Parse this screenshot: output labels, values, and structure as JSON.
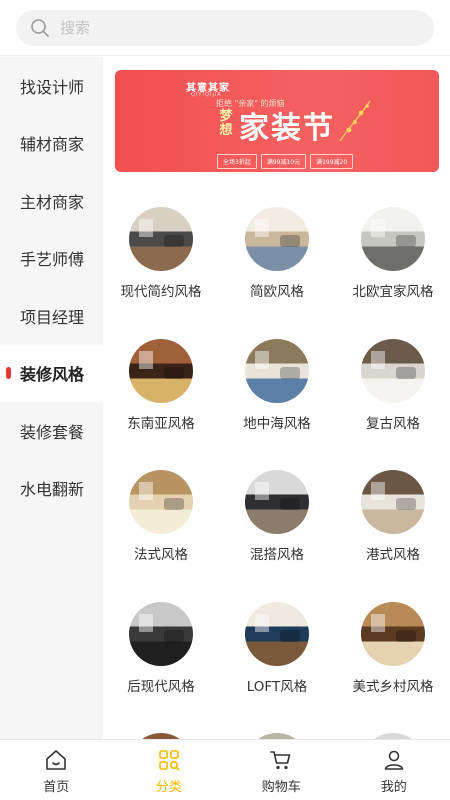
{
  "search": {
    "placeholder": "搜索",
    "icon": "search-icon"
  },
  "sidebar": {
    "items": [
      {
        "label": "找设计师"
      },
      {
        "label": "辅材商家"
      },
      {
        "label": "主材商家"
      },
      {
        "label": "手艺师傅"
      },
      {
        "label": "项目经理"
      },
      {
        "label": "装修风格",
        "active": true
      },
      {
        "label": "装修套餐"
      },
      {
        "label": "水电翻新"
      }
    ]
  },
  "banner": {
    "logo": "其意其家",
    "logo_sub": "QIYIQIJIA",
    "tagline": "拒绝 \"亲家\" 的烦恼",
    "dream": "梦想",
    "title": "家装节",
    "promos": [
      "全场3折起",
      "满99减10元",
      "满199减20"
    ],
    "colors": {
      "background": "#f34f4f",
      "accent": "#fff3a6"
    }
  },
  "styles": [
    {
      "label": "现代简约风格",
      "palette": [
        "#4a4a4a",
        "#d8d0c2",
        "#8b6a4f"
      ]
    },
    {
      "label": "简欧风格",
      "palette": [
        "#c9b79c",
        "#f2ece2",
        "#7b8fa6"
      ]
    },
    {
      "label": "北欧宜家风格",
      "palette": [
        "#c7c7c2",
        "#f1f1ee",
        "#6e6e6a"
      ]
    },
    {
      "label": "东南亚风格",
      "palette": [
        "#3a2418",
        "#a0603a",
        "#d9b26a"
      ]
    },
    {
      "label": "地中海风格",
      "palette": [
        "#e9e4d8",
        "#8c7a5c",
        "#5b7fa6"
      ]
    },
    {
      "label": "复古风格",
      "palette": [
        "#d9d6d0",
        "#6b5b4b",
        "#f5f3ef"
      ]
    },
    {
      "label": "法式风格",
      "palette": [
        "#e5d2b0",
        "#b89463",
        "#f5ecd8"
      ]
    },
    {
      "label": "混搭风格",
      "palette": [
        "#2f2f33",
        "#d9d9d9",
        "#8a7d6b"
      ]
    },
    {
      "label": "港式风格",
      "palette": [
        "#e8e4dc",
        "#6b5844",
        "#c9b89f"
      ]
    },
    {
      "label": "后现代风格",
      "palette": [
        "#3a3a3a",
        "#c8c8c8",
        "#1f1f1f"
      ]
    },
    {
      "label": "LOFT风格",
      "palette": [
        "#1f3d5a",
        "#efe9df",
        "#7a5a3a"
      ]
    },
    {
      "label": "美式乡村风格",
      "palette": [
        "#5c3a22",
        "#b88a56",
        "#e6d2b0"
      ]
    }
  ],
  "tabbar": {
    "items": [
      {
        "label": "首页",
        "icon": "home-icon"
      },
      {
        "label": "分类",
        "icon": "category-icon",
        "active": true
      },
      {
        "label": "购物车",
        "icon": "cart-icon"
      },
      {
        "label": "我的",
        "icon": "user-icon"
      }
    ],
    "colors": {
      "active": "#f5b800",
      "inactive": "#333333"
    }
  }
}
